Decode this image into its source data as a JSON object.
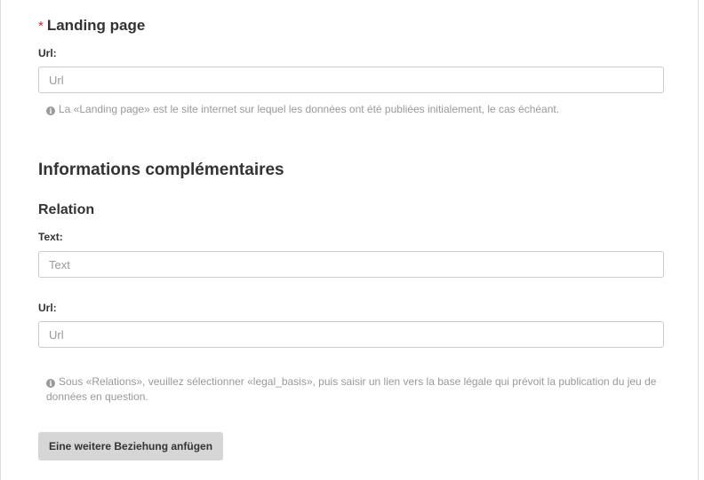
{
  "landing_page": {
    "required_mark": "*",
    "title": "Landing page",
    "url_label": "Url:",
    "url_placeholder": "Url",
    "url_value": "",
    "help_text": "La «Landing page» est le site internet sur lequel les données ont été publiées initialement, le cas échéant."
  },
  "additional_info": {
    "title": "Informations complémentaires",
    "relation": {
      "title": "Relation",
      "text_label": "Text:",
      "text_placeholder": "Text",
      "text_value": "",
      "url_label": "Url:",
      "url_placeholder": "Url",
      "url_value": "",
      "help_text": "Sous «Relations», veuillez sélectionner «legal_basis», puis saisir un lien vers la base légale qui prévoit la publication du jeu de données en question.",
      "add_button_label": "Eine weitere Beziehung anfügen"
    }
  },
  "icons": {
    "info": "info-circle-icon",
    "info_glyph": "i"
  }
}
